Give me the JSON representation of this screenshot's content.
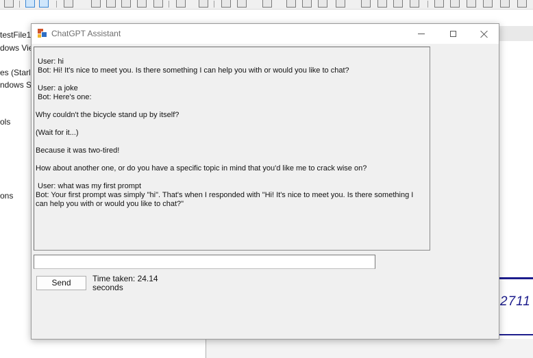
{
  "background_app": {
    "left_panel_items": [
      "testFile1",
      "dows Vie",
      "es (Starli",
      "ndows Sh",
      "ols",
      "ons"
    ],
    "right_number": "2711"
  },
  "window": {
    "title": "ChatGPT Assistant",
    "controls": {
      "minimize": "minimize",
      "maximize": "maximize",
      "close": "close"
    }
  },
  "chat": {
    "lines": [
      " User: hi",
      " Bot: Hi! It's nice to meet you. Is there something I can help you with or would you like to chat?",
      "",
      " User: a joke",
      " Bot: Here's one:",
      "",
      "Why couldn't the bicycle stand up by itself?",
      "",
      "(Wait for it...)",
      "",
      "Because it was two-tired!",
      "",
      "How about another one, or do you have a specific topic in mind that you'd like me to crack wise on?",
      "",
      " User: what was my first prompt"
    ],
    "last_bot_message": " Bot: Your first prompt was simply \"hi\". That's when I responded with \"Hi! It's nice to meet you. Is there something I can help you with or would you like to chat?\""
  },
  "input": {
    "value": "",
    "placeholder": ""
  },
  "send_label": "Send",
  "time_taken": "Time taken: 24.14 seconds",
  "colors": {
    "window_bg": "#f0f0f0",
    "titlebar_bg": "#ffffff",
    "accent_blue": "#1c1c8c"
  },
  "icons": {
    "app": "winforms-app-icon",
    "minimize": "minimize-icon",
    "maximize": "maximize-icon",
    "close": "close-icon"
  }
}
